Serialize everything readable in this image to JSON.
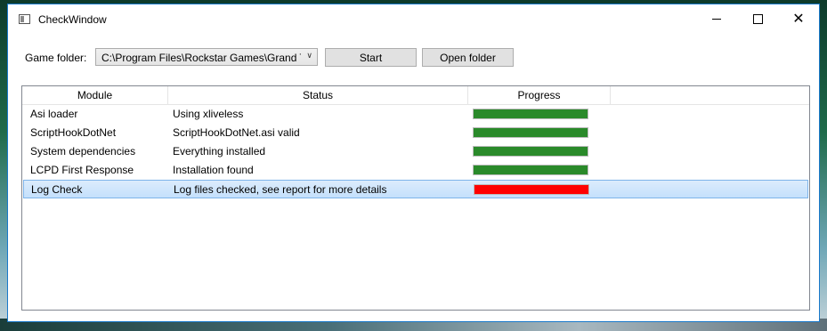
{
  "window": {
    "title": "CheckWindow"
  },
  "toolbar": {
    "folder_label": "Game folder:",
    "folder_value": "C:\\Program Files\\Rockstar Games\\Grand Theft Auto IV",
    "start_label": "Start",
    "open_label": "Open folder"
  },
  "table": {
    "headers": [
      "Module",
      "Status",
      "Progress"
    ],
    "rows": [
      {
        "module": "Asi loader",
        "status": "Using xliveless",
        "progress": 1.0,
        "color": "#2a8a2a"
      },
      {
        "module": "ScriptHookDotNet",
        "status": "ScriptHookDotNet.asi valid",
        "progress": 1.0,
        "color": "#2a8a2a"
      },
      {
        "module": "System dependencies",
        "status": "Everything installed",
        "progress": 1.0,
        "color": "#2a8a2a"
      },
      {
        "module": "LCPD First Response",
        "status": "Installation found",
        "progress": 1.0,
        "color": "#2a8a2a"
      },
      {
        "module": "Log Check",
        "status": "Log files checked, see report for more details",
        "progress": 1.0,
        "color": "#ff0000",
        "selected": true
      }
    ]
  }
}
